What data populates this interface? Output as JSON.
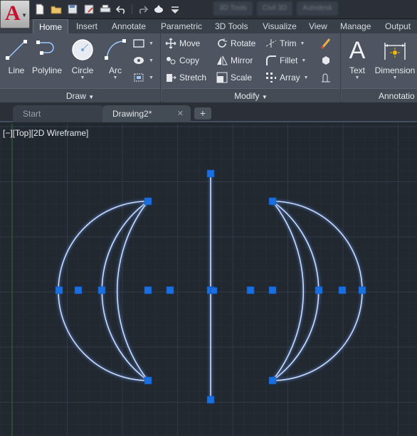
{
  "app": {
    "icon": "autocad-logo",
    "letter": "A"
  },
  "quick_access": {
    "icons": [
      "new-icon",
      "open-icon",
      "save-icon",
      "save-as-icon",
      "plot-icon",
      "undo-icon",
      "redo-icon",
      "share-icon",
      "customize-icon"
    ]
  },
  "background_tabs": [
    "3D Tools",
    "Civil 3D",
    "Autodesk"
  ],
  "ribbon_tabs": [
    {
      "label": "Home",
      "active": true
    },
    {
      "label": "Insert"
    },
    {
      "label": "Annotate"
    },
    {
      "label": "Parametric"
    },
    {
      "label": "3D Tools"
    },
    {
      "label": "Visualize"
    },
    {
      "label": "View"
    },
    {
      "label": "Manage"
    },
    {
      "label": "Output"
    }
  ],
  "panels": {
    "draw": {
      "title": "Draw",
      "line": "Line",
      "polyline": "Polyline",
      "circle": "Circle",
      "arc": "Arc"
    },
    "modify": {
      "title": "Modify",
      "move": "Move",
      "copy": "Copy",
      "stretch": "Stretch",
      "rotate": "Rotate",
      "mirror": "Mirror",
      "scale": "Scale",
      "trim": "Trim",
      "fillet": "Fillet",
      "array": "Array"
    },
    "annotation": {
      "title": "Annotatio",
      "text": "Text",
      "dimension": "Dimension"
    }
  },
  "file_tabs": {
    "start": "Start",
    "drawing": "Drawing2*",
    "close_glyph": "✕",
    "new_glyph": "+"
  },
  "viewport": {
    "label": "[−][Top][2D Wireframe]"
  },
  "colors": {
    "background": "#212830",
    "grid_minor": "#262d36",
    "grid_major": "#313b47",
    "axis_y": "#2f6b2f",
    "geometry": "#c9dcff",
    "grip": "#1a6fe0"
  }
}
